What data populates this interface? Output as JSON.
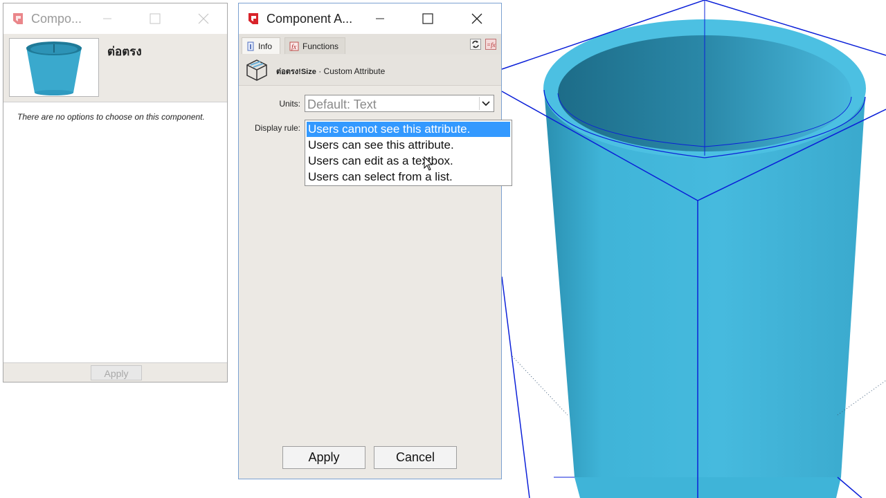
{
  "left_window": {
    "title": "Compo...",
    "component_name": "ต่อตรง",
    "no_options_text": "There are no options to choose on this component.",
    "apply_label": "Apply",
    "title_buttons": [
      "minimize-icon",
      "maximize-icon",
      "close-icon"
    ]
  },
  "right_window": {
    "title": "Component A...",
    "tabs": [
      {
        "label": "Info",
        "icon": "info-icon",
        "active": true
      },
      {
        "label": "Functions",
        "icon": "function-icon",
        "active": false
      }
    ],
    "toolbar_icons": [
      "refresh-icon",
      "toggle-formula-icon"
    ],
    "attribute": {
      "component": "ต่อตรง!Size",
      "separator": " · ",
      "label": "Custom Attribute"
    },
    "units_label": "Units:",
    "units_value": "Default: Text",
    "display_rule_label": "Display rule:",
    "display_rule_options": [
      "Users cannot see this attribute.",
      "Users can see this attribute.",
      "Users can edit as a textbox.",
      "Users can select from a list."
    ],
    "selected_option_index": 0,
    "apply_label": "Apply",
    "cancel_label": "Cancel"
  },
  "colors": {
    "accent": "#3399ff",
    "model_cyan": "#3fb4d8",
    "edge_blue": "#0a1fd8",
    "app_icon_red": "#d8232a"
  }
}
